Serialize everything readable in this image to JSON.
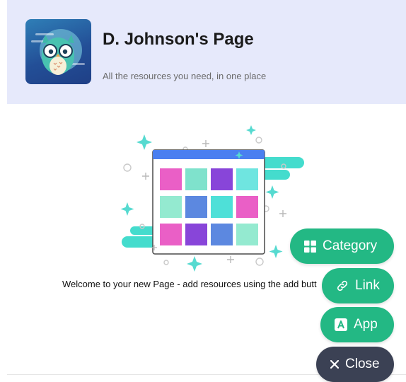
{
  "header": {
    "title": "D. Johnson's Page",
    "subtitle": "All the resources you need, in one place",
    "avatar_icon": "owl-avatar-icon"
  },
  "main": {
    "illustration_icon": "board-grid-illustration-icon",
    "welcome": "Welcome to your new Page - add resources using the add butt"
  },
  "fab_menu": {
    "category": "Category",
    "link": "Link",
    "app": "App",
    "close": "Close"
  },
  "colors": {
    "accent": "#23b884",
    "close_button": "#3b4154",
    "header_bg": "#e6e9fb"
  }
}
